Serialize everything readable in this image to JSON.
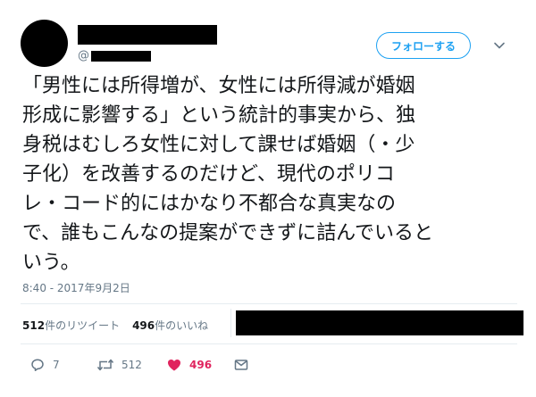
{
  "tweet": {
    "follow_label": "フォローする",
    "handle_prefix": "@",
    "text": "「男性には所得増が、女性には所得減が婚姻\n形成に影響する」という統計的事実から、独\n身税はむしろ女性に対して課せば婚姻（・少\n子化）を改善するのだけど、現代のポリコ\nレ・コード的にはかなり不都合な真実なの\nで、誰もこんなの提案ができずに詰んでいると\nいう。",
    "timestamp": "8:40 - 2017年9月2日"
  },
  "stats": {
    "retweets_count": "512",
    "retweets_label": "件のリツイート",
    "likes_count": "496",
    "likes_label": "件のいいね"
  },
  "actions": {
    "reply_count": "7",
    "retweet_count": "512",
    "like_count": "496"
  },
  "colors": {
    "accent": "#1da1f2",
    "like": "#e0245e",
    "muted": "#657786",
    "text": "#14171a"
  },
  "icons": [
    "caret-down-icon",
    "reply-icon",
    "retweet-icon",
    "heart-icon",
    "message-icon"
  ]
}
